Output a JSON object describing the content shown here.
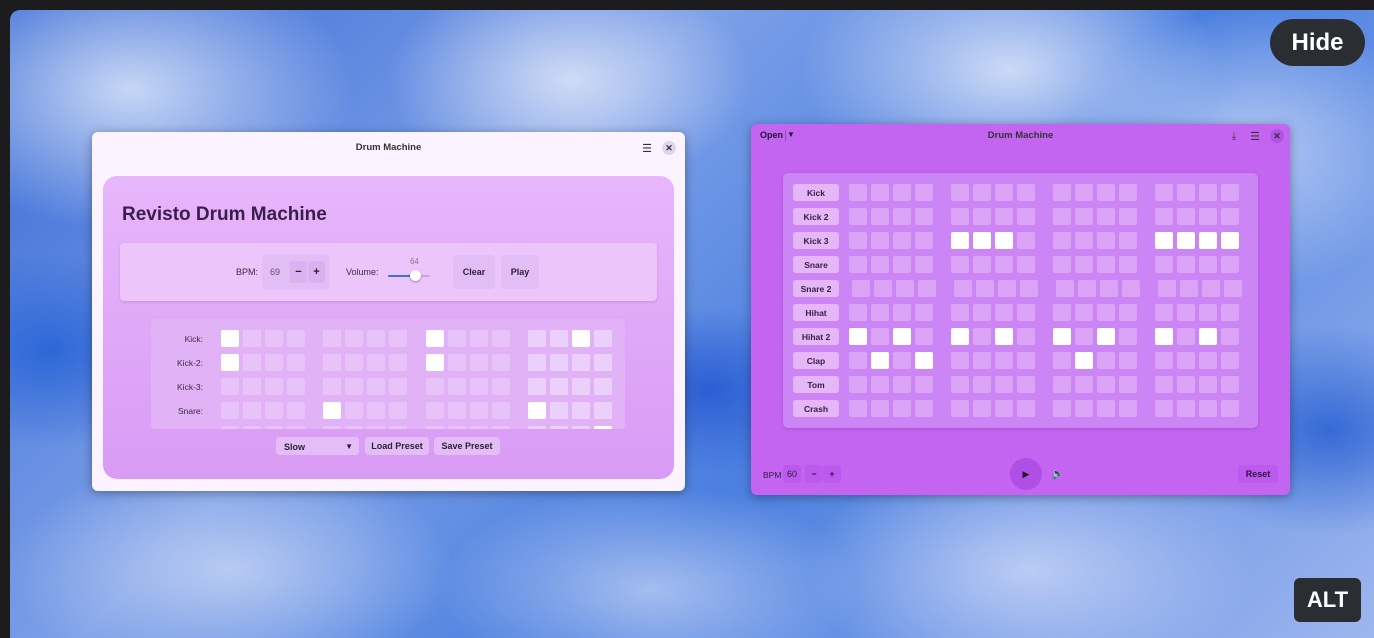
{
  "overlay": {
    "hide_label": "Hide",
    "alt_label": "ALT"
  },
  "window1": {
    "title": "Drum Machine",
    "heading": "Revisto Drum Machine",
    "bpm_label": "BPM:",
    "bpm_value": "69",
    "minus": "−",
    "plus": "+",
    "volume_label": "Volume:",
    "volume_value": "64",
    "volume_fraction": 0.64,
    "clear_label": "Clear",
    "play_label": "Play",
    "rows": [
      {
        "label": "Kick:",
        "on": [
          0,
          8,
          14
        ]
      },
      {
        "label": "Kick-2:",
        "on": [
          0,
          8
        ]
      },
      {
        "label": "Kick-3:",
        "on": []
      },
      {
        "label": "Snare:",
        "on": [
          4,
          12
        ]
      },
      {
        "label": "",
        "on": [
          15
        ]
      }
    ],
    "preset_select": "Slow",
    "load_preset_label": "Load Preset",
    "save_preset_label": "Save Preset"
  },
  "window2": {
    "title": "Drum Machine",
    "open_label": "Open",
    "rows": [
      {
        "label": "Kick",
        "on": []
      },
      {
        "label": "Kick 2",
        "on": []
      },
      {
        "label": "Kick 3",
        "on": [
          4,
          5,
          6,
          12,
          13,
          14,
          15
        ]
      },
      {
        "label": "Snare",
        "on": []
      },
      {
        "label": "Snare 2",
        "on": []
      },
      {
        "label": "Hihat",
        "on": []
      },
      {
        "label": "Hihat 2",
        "on": [
          0,
          2,
          4,
          6,
          8,
          10,
          12,
          14
        ]
      },
      {
        "label": "Clap",
        "on": [
          1,
          3,
          9
        ]
      },
      {
        "label": "Tom",
        "on": []
      },
      {
        "label": "Crash",
        "on": []
      }
    ],
    "bpm_label": "BPM",
    "bpm_value": "60",
    "minus": "−",
    "plus": "+",
    "reset_label": "Reset"
  },
  "icons": {
    "menu": "hamburger-icon",
    "close": "close-icon",
    "download": "download-icon",
    "play": "play-icon",
    "volume": "speaker-icon",
    "caret": "chevron-down-icon"
  }
}
